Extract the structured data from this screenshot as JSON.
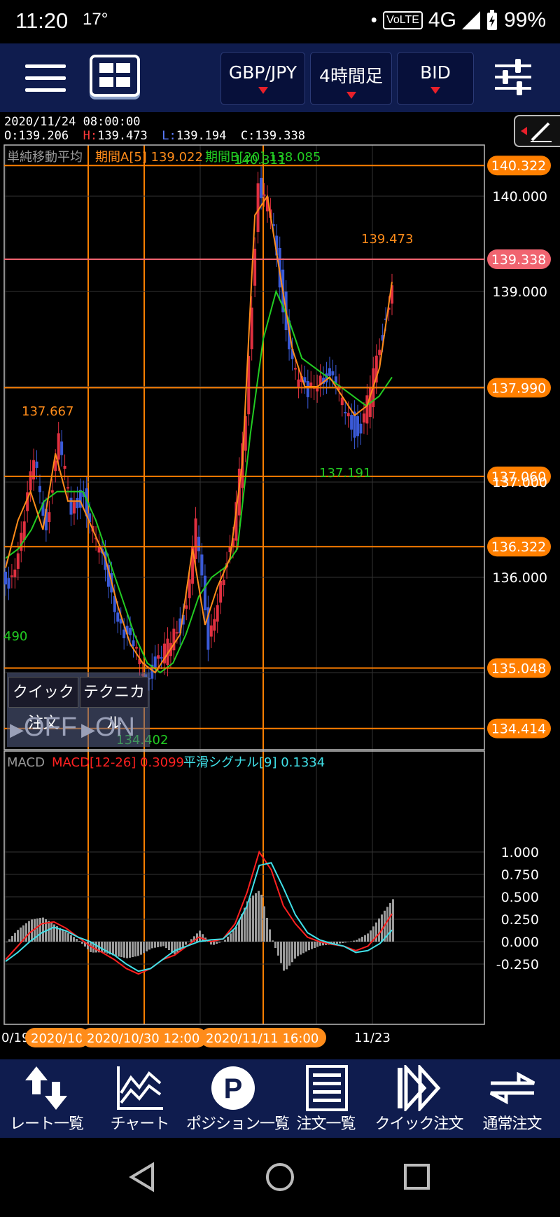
{
  "status_bar": {
    "time": "11:20",
    "temperature": "17°",
    "network_badge": "VoLTE",
    "network": "4G",
    "battery": "99%"
  },
  "toolbar": {
    "pair": "GBP/JPY",
    "timeframe": "4時間足",
    "price_type": "BID"
  },
  "ohlc": {
    "datetime": "2020/11/24 08:00:00",
    "open_label": "O:",
    "open": "139.206",
    "high_label": "H:",
    "high": "139.473",
    "low_label": "L:",
    "low": "139.194",
    "close_label": "C:",
    "close": "139.338"
  },
  "price_panel": {
    "legend_name": "単純移動平均",
    "legend_a": "期間A[5] 139.022",
    "legend_b": "期間B[20] 138.085",
    "axis_ticks": [
      "140.000",
      "139.000",
      "137.000",
      "136.000"
    ],
    "hlines": [
      {
        "value": "140.322",
        "color": "#ff7f00"
      },
      {
        "value": "139.338",
        "color": "#f06470"
      },
      {
        "value": "137.990",
        "color": "#ff7f00"
      },
      {
        "value": "137.060",
        "color": "#ff7f00"
      },
      {
        "value": "136.322",
        "color": "#ff7f00"
      },
      {
        "value": "135.048",
        "color": "#ff7f00"
      },
      {
        "value": "134.414",
        "color": "#ff7f00"
      }
    ],
    "annotations": {
      "peak": "140.311",
      "recent_high": "139.473",
      "left_high": "137.667",
      "recent_low": "137.191",
      "left_value": "490",
      "bottom_low": "134.402"
    }
  },
  "macd_panel": {
    "legend_name": "MACD",
    "legend_macd": "MACD[12-26] 0.3099",
    "legend_signal": "平滑シグナル[9] 0.1334",
    "axis_ticks": [
      "1.000",
      "0.750",
      "0.500",
      "0.250",
      "0.000",
      "-0.250"
    ]
  },
  "x_axis": {
    "left_edge": "0/19",
    "labels": [
      "2020/10",
      "2020/10/30 12:00",
      "2020/11/11 16:00"
    ],
    "right_label": "11/23"
  },
  "quick_panel": {
    "quick_order_label": "クイック注文",
    "quick_order_state": "OFF",
    "technical_label": "テクニカル",
    "technical_state": "ON"
  },
  "bottom_nav": [
    {
      "label": "レート一覧",
      "icon": "rate-list-icon"
    },
    {
      "label": "チャート",
      "icon": "chart-icon"
    },
    {
      "label": "ポジション一覧",
      "icon": "position-icon"
    },
    {
      "label": "注文一覧",
      "icon": "order-list-icon"
    },
    {
      "label": "クイック注文",
      "icon": "quick-order-icon"
    },
    {
      "label": "通常注文",
      "icon": "normal-order-icon"
    }
  ],
  "colors": {
    "navbar": "#0f1c4e",
    "sma_a": "#ff8c1a",
    "sma_b": "#22cc22",
    "macd": "#ff2020",
    "signal": "#40e0e8",
    "grid": "#333333",
    "hline": "#ff7f00",
    "current_price": "#f06470"
  },
  "chart_data": [
    {
      "type": "candlestick",
      "title": "GBP/JPY 4時間足",
      "ylim": [
        134.2,
        140.7
      ],
      "x_labels": [
        "0/19",
        "2020/10",
        "2020/10/30 12:00",
        "2020/11/11 16:00",
        "11/23"
      ],
      "series": [
        {
          "name": "期間A[5]",
          "values": [
            136.1,
            136.6,
            136.9,
            136.5,
            137.3,
            136.8,
            136.8,
            136.5,
            136.2,
            135.7,
            135.3,
            135.1,
            135.0,
            135.2,
            135.4,
            136.3,
            135.5,
            135.9,
            136.2,
            137.2,
            139.8,
            140.0,
            139.2,
            138.4,
            138.0,
            138.0,
            138.1,
            137.9,
            137.7,
            137.8,
            138.2,
            139.1
          ]
        },
        {
          "name": "期間B[20]",
          "values": [
            136.2,
            136.3,
            136.5,
            136.8,
            136.9,
            136.9,
            136.9,
            136.6,
            136.2,
            135.8,
            135.4,
            135.1,
            135.0,
            135.1,
            135.4,
            135.8,
            136.0,
            136.1,
            136.3,
            137.5,
            138.5,
            139.0,
            138.7,
            138.3,
            138.2,
            138.1,
            138.0,
            137.9,
            137.8,
            137.9,
            138.1
          ]
        },
        {
          "name": "close",
          "values": [
            136.0,
            136.4,
            137.2,
            136.6,
            137.4,
            136.7,
            136.9,
            136.3,
            136.0,
            135.5,
            135.2,
            135.0,
            135.1,
            135.3,
            135.6,
            136.5,
            135.3,
            136.0,
            136.3,
            137.8,
            140.1,
            139.8,
            138.9,
            138.1,
            137.9,
            138.2,
            138.0,
            137.8,
            137.5,
            137.9,
            138.6,
            139.3
          ]
        }
      ]
    },
    {
      "type": "line",
      "title": "MACD",
      "ylim": [
        -0.33,
        1.06
      ],
      "series": [
        {
          "name": "MACD[12-26]",
          "values": [
            -0.2,
            -0.05,
            0.1,
            0.2,
            0.22,
            0.15,
            0.05,
            -0.05,
            -0.12,
            -0.2,
            -0.3,
            -0.36,
            -0.3,
            -0.2,
            -0.15,
            -0.05,
            0.05,
            0.0,
            0.03,
            0.2,
            0.55,
            1.0,
            0.8,
            0.4,
            0.2,
            0.05,
            0.0,
            -0.03,
            -0.05,
            -0.1,
            -0.05,
            0.1,
            0.31
          ]
        },
        {
          "name": "平滑シグナル[9]",
          "values": [
            -0.22,
            -0.12,
            0.0,
            0.1,
            0.16,
            0.12,
            0.05,
            0.0,
            -0.08,
            -0.15,
            -0.25,
            -0.33,
            -0.3,
            -0.2,
            -0.1,
            -0.05,
            0.0,
            0.02,
            0.03,
            0.15,
            0.4,
            0.85,
            0.88,
            0.6,
            0.3,
            0.1,
            0.02,
            -0.02,
            -0.05,
            -0.12,
            -0.1,
            -0.02,
            0.13
          ]
        }
      ]
    }
  ]
}
